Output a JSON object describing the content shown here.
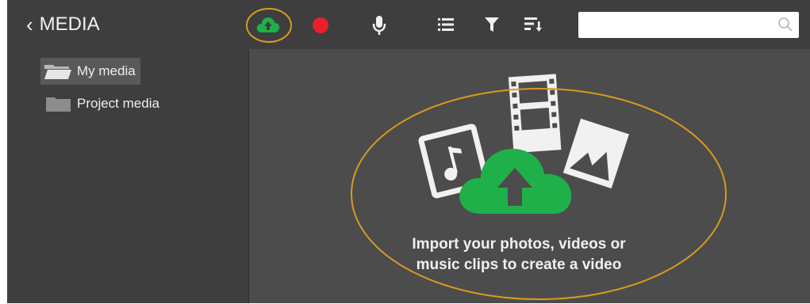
{
  "header": {
    "back_label": "MEDIA",
    "icons": [
      "cloud-upload-icon",
      "record-icon",
      "microphone-icon",
      "list-view-icon",
      "filter-icon",
      "sort-icon"
    ],
    "search": {
      "placeholder": "",
      "value": ""
    }
  },
  "sidebar": {
    "items": [
      {
        "label": "My media",
        "icon": "folder-open-icon",
        "active": true
      },
      {
        "label": "Project media",
        "icon": "folder-icon",
        "active": false
      }
    ]
  },
  "main": {
    "empty_state": {
      "line1": "Import your photos, videos or",
      "line2": "music clips to create a video"
    }
  },
  "colors": {
    "toolbar_bg": "#3e3e3e",
    "content_bg": "#4c4c4c",
    "upload_green": "#1fb04a",
    "record_red": "#e8202a",
    "highlight_ring": "#d99a1e"
  }
}
